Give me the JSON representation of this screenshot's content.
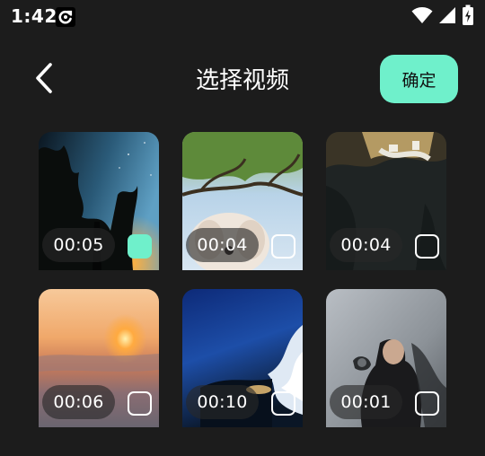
{
  "status_bar": {
    "time": "1:42",
    "app_icon": "c-arrow-icon",
    "icons": [
      "wifi-icon",
      "cellular-signal-icon",
      "battery-charging-icon"
    ]
  },
  "header": {
    "back_icon": "chevron-left-icon",
    "title": "选择视频",
    "confirm_label": "确定"
  },
  "colors": {
    "background": "#1c1c1c",
    "accent": "#6ff0cb",
    "text": "#ffffff"
  },
  "videos": [
    {
      "duration": "00:05",
      "selected": true,
      "scene": "night forest sky"
    },
    {
      "duration": "00:04",
      "selected": false,
      "scene": "dog under tree branches"
    },
    {
      "duration": "00:04",
      "selected": false,
      "scene": "cartoon face closeup"
    },
    {
      "duration": "00:06",
      "selected": false,
      "scene": "sunset over clouds"
    },
    {
      "duration": "00:10",
      "selected": false,
      "scene": "blue sky with clouds"
    },
    {
      "duration": "00:01",
      "selected": false,
      "scene": "figure in grey mist"
    }
  ]
}
